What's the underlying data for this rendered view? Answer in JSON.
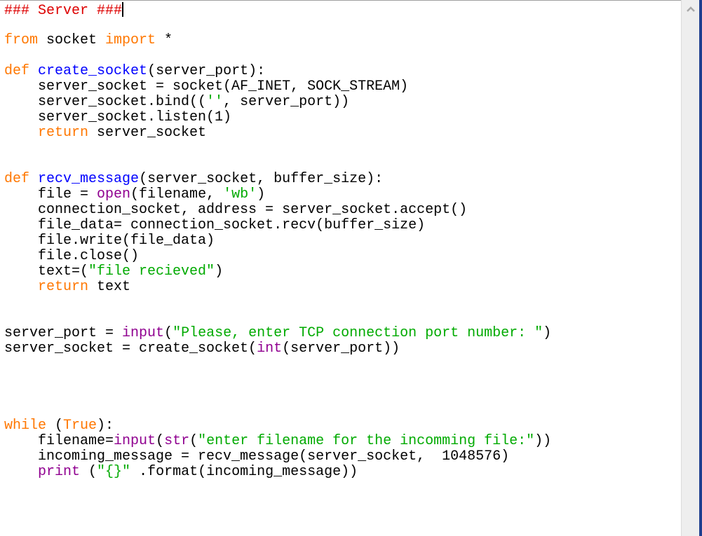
{
  "editor": {
    "lines": [
      [
        {
          "t": "### Server ###",
          "c": "comment"
        }
      ],
      [],
      [
        {
          "t": "from",
          "c": "keyword"
        },
        {
          "t": " socket "
        },
        {
          "t": "import",
          "c": "keyword"
        },
        {
          "t": " *"
        }
      ],
      [],
      [
        {
          "t": "def",
          "c": "keyword"
        },
        {
          "t": " "
        },
        {
          "t": "create_socket",
          "c": "defname"
        },
        {
          "t": "(server_port):"
        }
      ],
      [
        {
          "t": "    server_socket = socket(AF_INET, SOCK_STREAM)"
        }
      ],
      [
        {
          "t": "    server_socket.bind(("
        },
        {
          "t": "''",
          "c": "string"
        },
        {
          "t": ", server_port))"
        }
      ],
      [
        {
          "t": "    server_socket.listen(1)"
        }
      ],
      [
        {
          "t": "    "
        },
        {
          "t": "return",
          "c": "keyword"
        },
        {
          "t": " server_socket"
        }
      ],
      [],
      [],
      [
        {
          "t": "def",
          "c": "keyword"
        },
        {
          "t": " "
        },
        {
          "t": "recv_message",
          "c": "defname"
        },
        {
          "t": "(server_socket, buffer_size):"
        }
      ],
      [
        {
          "t": "    file = "
        },
        {
          "t": "open",
          "c": "builtin"
        },
        {
          "t": "(filename, "
        },
        {
          "t": "'wb'",
          "c": "string"
        },
        {
          "t": ")"
        }
      ],
      [
        {
          "t": "    connection_socket, address = server_socket.accept()"
        }
      ],
      [
        {
          "t": "    file_data= connection_socket.recv(buffer_size)"
        }
      ],
      [
        {
          "t": "    file.write(file_data)"
        }
      ],
      [
        {
          "t": "    file.close()"
        }
      ],
      [
        {
          "t": "    text=("
        },
        {
          "t": "\"file recieved\"",
          "c": "string"
        },
        {
          "t": ")"
        }
      ],
      [
        {
          "t": "    "
        },
        {
          "t": "return",
          "c": "keyword"
        },
        {
          "t": " text"
        }
      ],
      [],
      [],
      [
        {
          "t": "server_port = "
        },
        {
          "t": "input",
          "c": "builtin"
        },
        {
          "t": "("
        },
        {
          "t": "\"Please, enter TCP connection port number: \"",
          "c": "string"
        },
        {
          "t": ")"
        }
      ],
      [
        {
          "t": "server_socket = create_socket("
        },
        {
          "t": "int",
          "c": "builtin"
        },
        {
          "t": "(server_port))"
        }
      ],
      [],
      [],
      [],
      [],
      [
        {
          "t": "while",
          "c": "keyword"
        },
        {
          "t": " ("
        },
        {
          "t": "True",
          "c": "keyword"
        },
        {
          "t": "):"
        }
      ],
      [
        {
          "t": "    filename="
        },
        {
          "t": "input",
          "c": "builtin"
        },
        {
          "t": "("
        },
        {
          "t": "str",
          "c": "builtin"
        },
        {
          "t": "("
        },
        {
          "t": "\"enter filename for the incomming file:\"",
          "c": "string"
        },
        {
          "t": "))"
        }
      ],
      [
        {
          "t": "    incoming_message = recv_message(server_socket,  1048576)"
        }
      ],
      [
        {
          "t": "    "
        },
        {
          "t": "print",
          "c": "builtin"
        },
        {
          "t": " ("
        },
        {
          "t": "\"{}\"",
          "c": "string"
        },
        {
          "t": " .format(incoming_message))"
        }
      ]
    ],
    "cursor_line": 0
  },
  "scrollbar": {
    "up_icon": "^"
  },
  "colors": {
    "comment": "#dd0000",
    "keyword": "#ff7700",
    "defname": "#0000ff",
    "builtin": "#900090",
    "string": "#00aa00"
  }
}
